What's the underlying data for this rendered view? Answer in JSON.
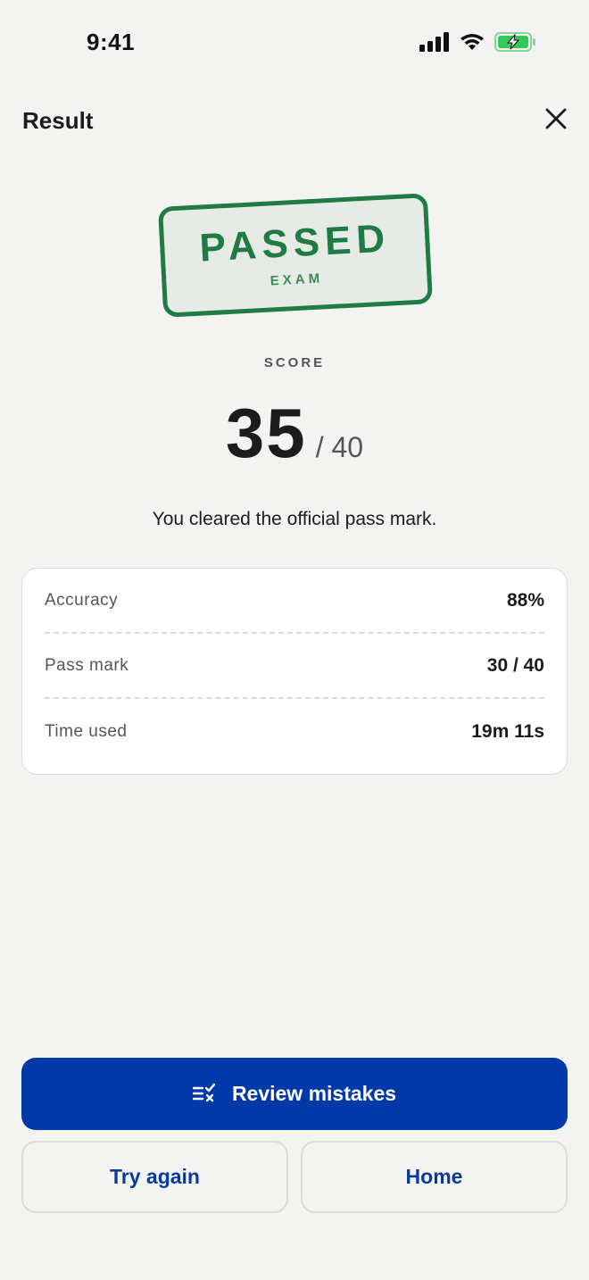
{
  "status_bar": {
    "time": "9:41",
    "icons": [
      "cellular-signal-icon",
      "wifi-icon",
      "battery-charging-icon"
    ]
  },
  "header": {
    "title": "Result",
    "close_icon": "close-icon"
  },
  "stamp": {
    "main": "PASSED",
    "sub": "EXAM"
  },
  "score": {
    "label": "SCORE",
    "value": "35",
    "total": "/ 40",
    "message": "You cleared the official pass mark."
  },
  "stats": [
    {
      "label": "Accuracy",
      "value": "88%"
    },
    {
      "label": "Pass mark",
      "value": "30 / 40"
    },
    {
      "label": "Time used",
      "value": "19m 11s"
    }
  ],
  "actions": {
    "review_label": "Review mistakes",
    "review_icon": "review-list-icon",
    "try_again_label": "Try again",
    "home_label": "Home"
  },
  "colors": {
    "background": "#f3f3f1",
    "stamp_green": "#1f7a43",
    "primary_blue": "#0239a8",
    "secondary_text_blue": "#0a3a9e",
    "battery_green": "#34c759"
  }
}
